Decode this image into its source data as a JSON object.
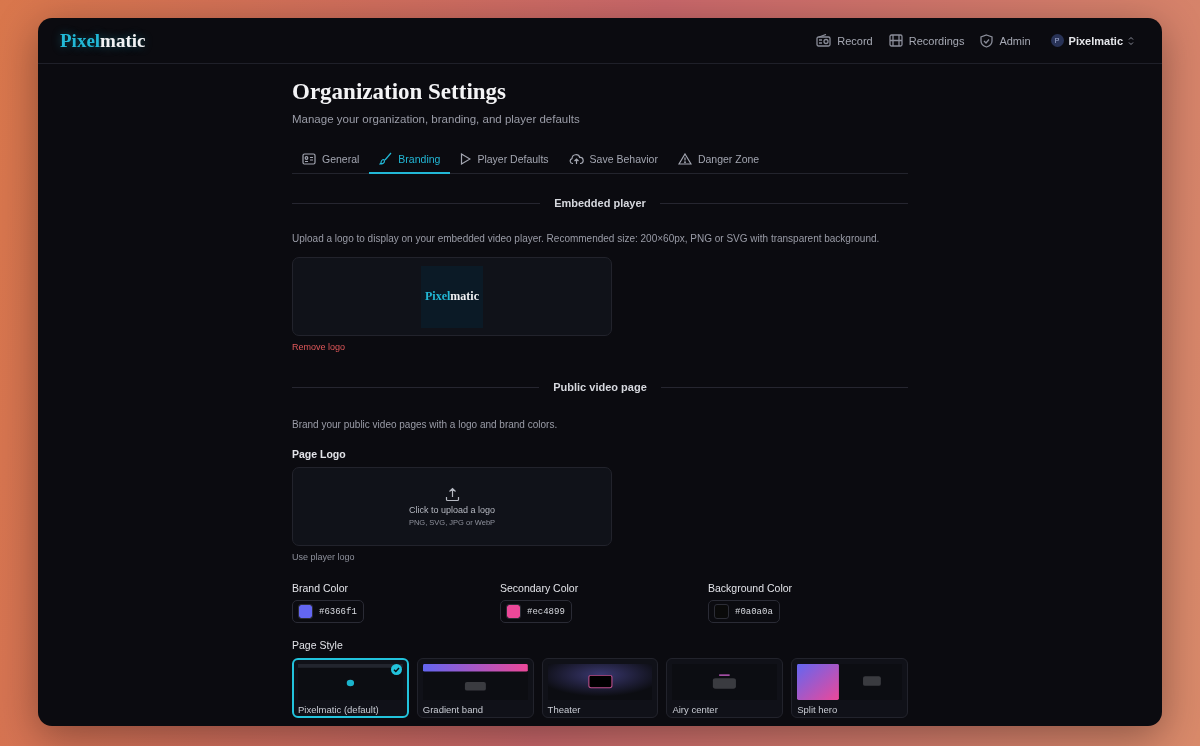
{
  "app": {
    "logo_accent": "Pixel",
    "logo_rest": "matic"
  },
  "nav": [
    {
      "kind": "record",
      "label": "Record"
    },
    {
      "kind": "film",
      "label": "Recordings"
    },
    {
      "kind": "shield",
      "label": "Admin"
    }
  ],
  "account": {
    "avatar": "P",
    "name": "Pixelmatic"
  },
  "page": {
    "title": "Organization Settings",
    "subtitle": "Manage your organization, branding, and player defaults"
  },
  "tabs": [
    {
      "kind": "card",
      "label": "General",
      "selected": false
    },
    {
      "kind": "brush",
      "label": "Branding",
      "selected": true
    },
    {
      "kind": "play",
      "label": "Player Defaults",
      "selected": false
    },
    {
      "kind": "cloud",
      "label": "Save Behavior",
      "selected": false
    },
    {
      "kind": "warning",
      "label": "Danger Zone",
      "selected": false
    }
  ],
  "embedded": {
    "heading": "Embedded player",
    "description": "Upload a logo to display on your embedded video player. Recommended size: 200×60px, PNG or SVG with transparent background.",
    "logo_accent": "Pixel",
    "logo_rest": "matic",
    "remove": "Remove logo"
  },
  "public_page": {
    "heading": "Public video page",
    "description": "Brand your public video pages with a logo and brand colors.",
    "logo_label": "Page Logo",
    "upload_title": "Click to upload a logo",
    "upload_hint": "PNG, SVG, JPG or WebP",
    "use_player": "Use player logo",
    "colors": [
      {
        "label": "Brand Color",
        "value": "#6366f1",
        "color": "#6366f1"
      },
      {
        "label": "Secondary Color",
        "value": "#ec4899",
        "color": "#ec4899"
      },
      {
        "label": "Background Color",
        "value": "#0a0a0a",
        "color": "#0a0a0a"
      }
    ],
    "style_label": "Page Style",
    "styles": [
      {
        "kind": "default",
        "label": "Pixelmatic (default)",
        "selected": true
      },
      {
        "kind": "gradient",
        "label": "Gradient band",
        "selected": false
      },
      {
        "kind": "theater",
        "label": "Theater",
        "selected": false
      },
      {
        "kind": "airy",
        "label": "Airy center",
        "selected": false
      },
      {
        "kind": "split",
        "label": "Split hero",
        "selected": false
      }
    ]
  }
}
